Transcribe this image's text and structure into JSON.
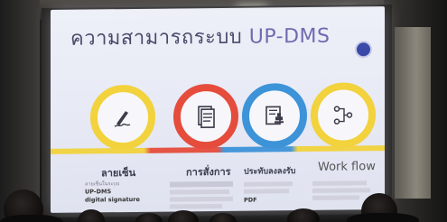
{
  "slide": {
    "title_prefix": "ความสามารถระบบ",
    "title_accent": "UP-DMS"
  },
  "features": [
    {
      "label": "ลายเซ็น",
      "icon": "pen-signature-icon",
      "ring_color": "#f2d23d",
      "body_lines": [
        "ลายเซ็นในระบบ",
        "UP-DMS",
        "digital signature"
      ]
    },
    {
      "label": "การสั่งการ",
      "icon": "document-icon",
      "ring_color": "#e54c3c",
      "body_lines": []
    },
    {
      "label": "ประทับลงลงรับ",
      "icon": "stamp-document-icon",
      "ring_color": "#3d93d8",
      "body_lines": [
        "PDF"
      ]
    },
    {
      "label": "Work flow",
      "icon": "workflow-icon",
      "ring_color": "#f2d23d",
      "body_lines": []
    }
  ],
  "colors": {
    "accent_purple": "#6f6bb0",
    "title_gray": "#4a4a6a",
    "yellow": "#f2d23d",
    "red": "#e54c3c",
    "blue": "#3d93d8"
  }
}
